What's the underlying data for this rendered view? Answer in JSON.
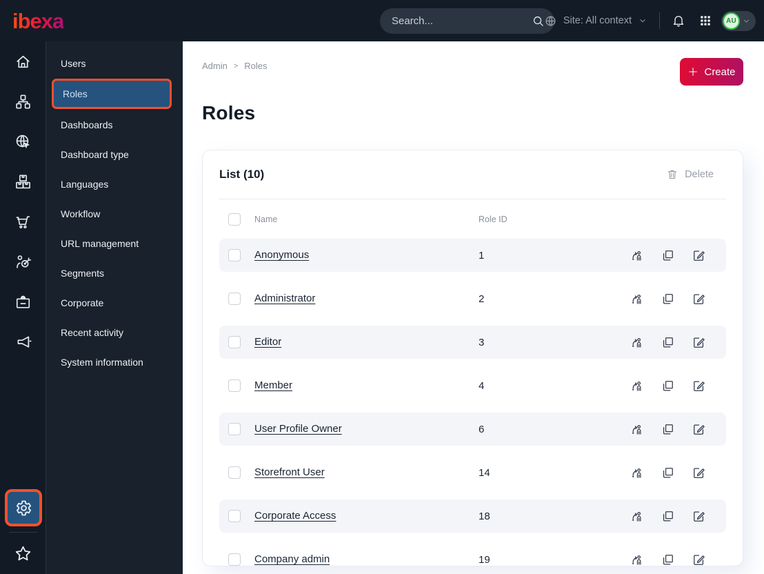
{
  "colors": {
    "topbar_bg": "#131c26",
    "accent_orange": "#f4502a",
    "selected_blue": "#25537e",
    "create_gradient_start": "#e00b33",
    "create_gradient_end": "#ad1164",
    "avatar_green": "#38c24c",
    "row_stripe": "#f4f5f8"
  },
  "topbar": {
    "logo": "ibexa",
    "search_placeholder": "Search...",
    "site_context_label": "Site: All context",
    "avatar_initials": "AU",
    "icons": [
      "site-globe-icon",
      "chevron-down-icon",
      "bell-icon",
      "app-grid-icon"
    ]
  },
  "sidebar": {
    "rail_icons": [
      "home",
      "content-structure",
      "site",
      "product-catalog",
      "commerce",
      "personalization",
      "corporate",
      "campaigns",
      "settings",
      "bookmarks"
    ],
    "menu_items": [
      {
        "label": "Users",
        "active": false
      },
      {
        "label": "Roles",
        "active": true
      },
      {
        "label": "Dashboards",
        "active": false
      },
      {
        "label": "Dashboard type",
        "active": false
      },
      {
        "label": "Languages",
        "active": false
      },
      {
        "label": "Workflow",
        "active": false
      },
      {
        "label": "URL management",
        "active": false
      },
      {
        "label": "Segments",
        "active": false
      },
      {
        "label": "Corporate",
        "active": false
      },
      {
        "label": "Recent activity",
        "active": false
      },
      {
        "label": "System information",
        "active": false
      }
    ]
  },
  "main": {
    "breadcrumb": {
      "items": [
        "Admin",
        "Roles"
      ],
      "separator": ">"
    },
    "create_label": "Create",
    "title": "Roles",
    "list": {
      "title": "List (10)",
      "delete_label": "Delete",
      "columns": {
        "name": "Name",
        "role_id": "Role ID"
      },
      "rows": [
        {
          "name": "Anonymous",
          "id": "1"
        },
        {
          "name": "Administrator",
          "id": "2"
        },
        {
          "name": "Editor",
          "id": "3"
        },
        {
          "name": "Member",
          "id": "4"
        },
        {
          "name": "User Profile Owner",
          "id": "6"
        },
        {
          "name": "Storefront User",
          "id": "14"
        },
        {
          "name": "Corporate Access",
          "id": "18"
        },
        {
          "name": "Company admin",
          "id": "19"
        }
      ]
    }
  }
}
